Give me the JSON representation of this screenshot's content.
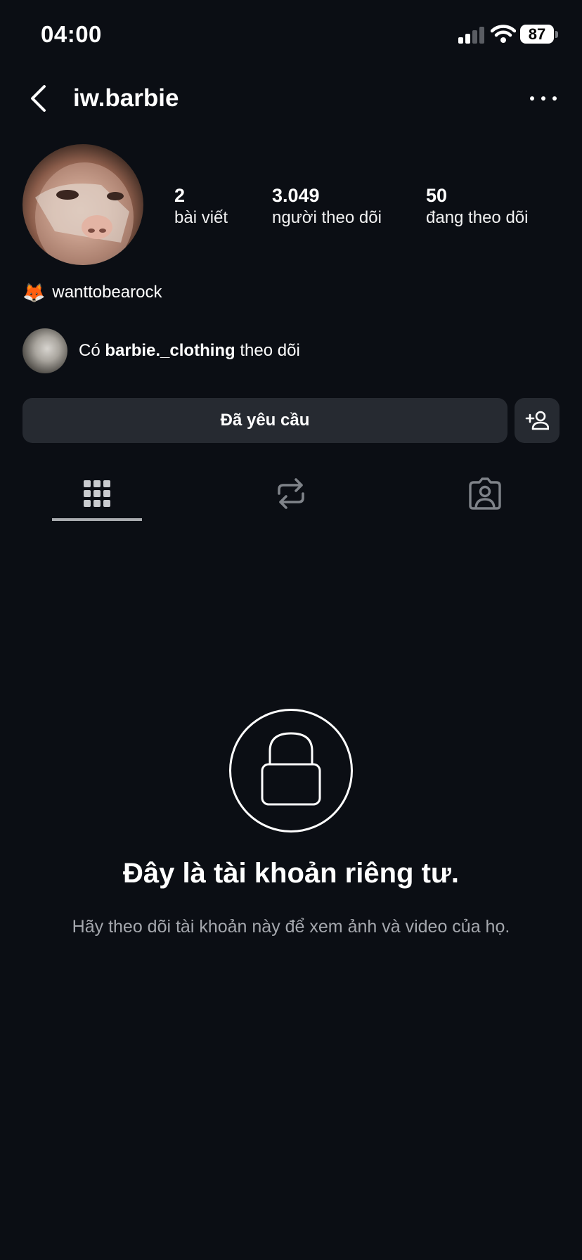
{
  "status_bar": {
    "time": "04:00",
    "battery": "87"
  },
  "header": {
    "username": "iw.barbie"
  },
  "profile": {
    "stats": [
      {
        "value": "2",
        "label": "bài viết"
      },
      {
        "value": "3.049",
        "label": "người theo dõi"
      },
      {
        "value": "50",
        "label": "đang theo dõi"
      }
    ],
    "bio": {
      "emoji": "🦊",
      "text": "wanttobearock"
    },
    "followed_by": {
      "prefix": "Có",
      "name": "barbie._clothing",
      "suffix": "theo dõi"
    }
  },
  "actions": {
    "requested_label": "Đã yêu cầu"
  },
  "tabs": [
    {
      "icon": "grid-icon",
      "active": true
    },
    {
      "icon": "repost-icon",
      "active": false
    },
    {
      "icon": "tagged-icon",
      "active": false
    }
  ],
  "private_notice": {
    "title": "Đây là tài khoản riêng tư.",
    "subtitle": "Hãy theo dõi tài khoản này để xem ảnh và video của họ."
  },
  "colors": {
    "background": "#0b0e14",
    "button": "#262a31",
    "muted_text": "#a4a7ad"
  }
}
